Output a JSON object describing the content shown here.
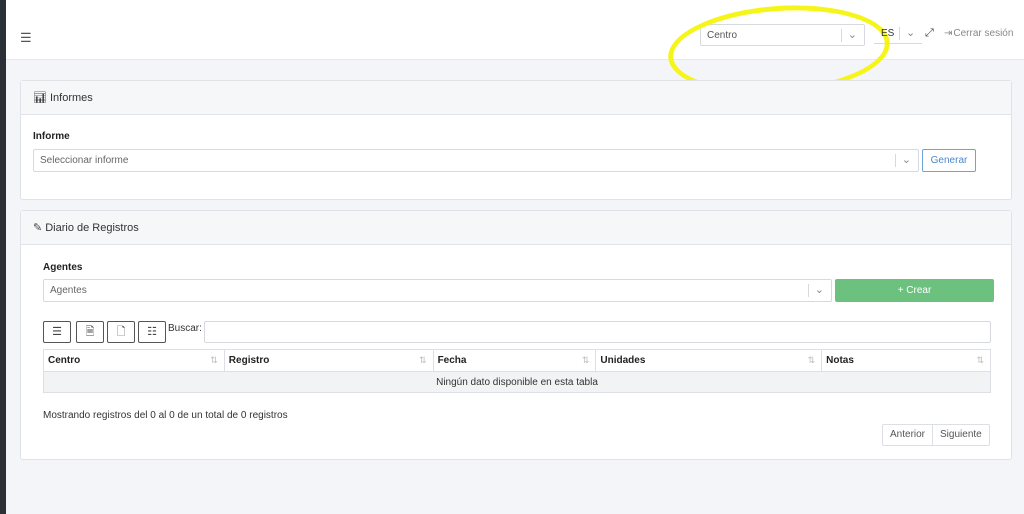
{
  "header": {
    "centro_select": {
      "value": "Centro"
    },
    "language": {
      "value": "ES"
    },
    "logout_label": "Cerrar sesión"
  },
  "informes_card": {
    "title": "Informes",
    "informe_label": "Informe",
    "informe_select_placeholder": "Seleccionar informe",
    "generar_label": "Generar"
  },
  "diario_card": {
    "title": "Diario de Registros",
    "agentes_label": "Agentes",
    "agentes_select_placeholder": "Agentes",
    "crear_label": "+ Crear",
    "buscar_label": "Buscar:",
    "buscar_value": "",
    "table": {
      "columns": [
        "Centro",
        "Registro",
        "Fecha",
        "Unidades",
        "Notas"
      ],
      "empty_message": "Ningún dato disponible en esta tabla"
    },
    "showing_text": "Mostrando registros del 0 al 0 de un total de 0 registros",
    "pagination": {
      "prev": "Anterior",
      "next": "Siguiente"
    }
  },
  "colors": {
    "primary_outline": "#4a88cc",
    "success": "#6cc17f",
    "highlight": "#f6f51a"
  },
  "icons": {
    "menu": "hamburger-menu-icon",
    "chart": "bar-chart-icon",
    "edit": "edit-square-icon",
    "expand": "expand-icon",
    "logout": "logout-icon"
  }
}
